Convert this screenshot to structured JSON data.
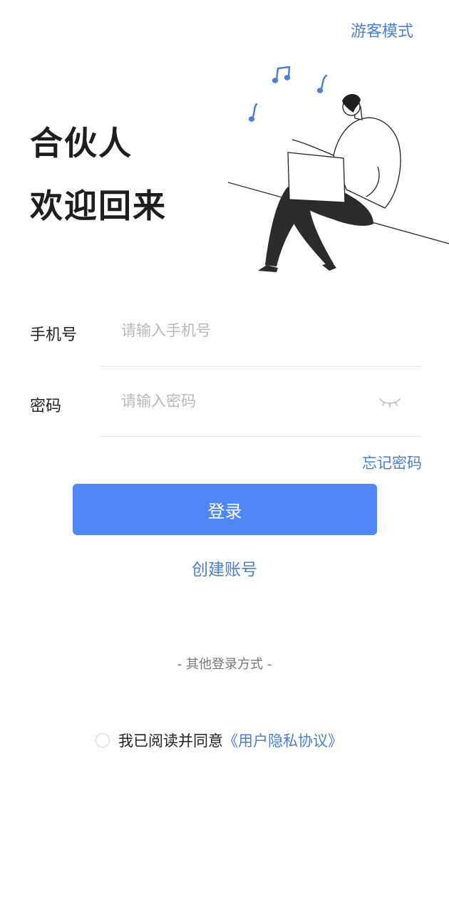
{
  "header": {
    "guest_mode_label": "游客模式"
  },
  "hero": {
    "title_line1": "合伙人",
    "title_line2": "欢迎回来",
    "illustration_icon": "person-with-laptop-music-illustration"
  },
  "form": {
    "phone_label": "手机号",
    "phone_placeholder": "请输入手机号",
    "phone_value": "",
    "password_label": "密码",
    "password_placeholder": "请输入密码",
    "password_value": "",
    "password_toggle_icon": "eye-closed-icon",
    "forgot_password_label": "忘记密码"
  },
  "actions": {
    "login_label": "登录",
    "create_account_label": "创建账号",
    "other_login_label": "- 其他登录方式 -"
  },
  "agreement": {
    "checked": false,
    "text": "我已阅读并同意",
    "link_text": "《用户隐私协议》"
  },
  "colors": {
    "accent": "#4f87f7",
    "link": "#4a7fd4",
    "title": "#1e1e1e",
    "placeholder": "#b8b8b8",
    "divider": "#e6e6e6"
  }
}
